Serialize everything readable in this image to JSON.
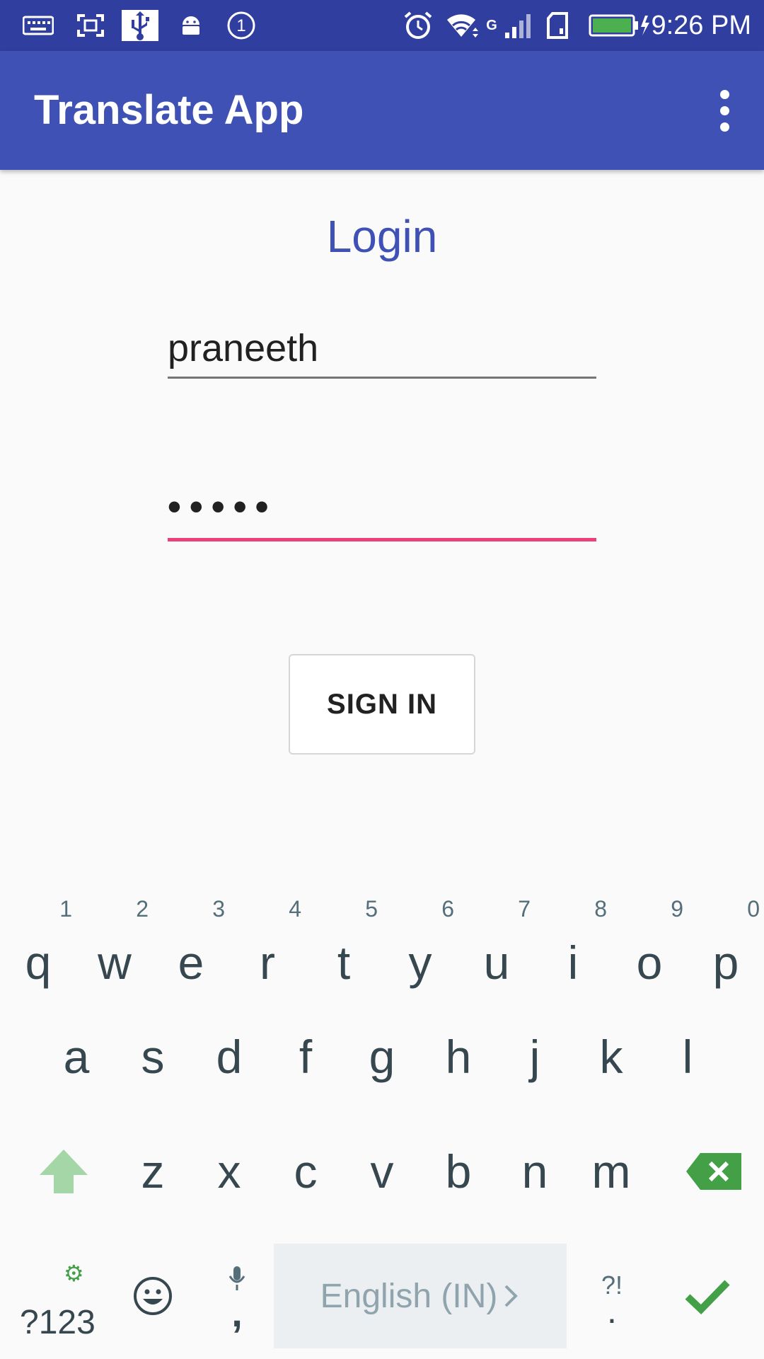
{
  "status_bar": {
    "time": "9:26 PM",
    "icons": [
      "keyboard-icon",
      "screenshot-icon",
      "usb-icon",
      "android-icon",
      "notification-count-icon",
      "alarm-icon",
      "wifi-icon",
      "cellular-signal-icon",
      "sim-icon",
      "battery-charging-icon"
    ],
    "notification_count": "1",
    "data_type": "G"
  },
  "app_bar": {
    "title": "Translate App",
    "menu_icon": "overflow-menu-icon",
    "color": "#3f51b5"
  },
  "login": {
    "title": "Login",
    "username_value": "praneeth",
    "password_value": "•••••",
    "signin_label": "SIGN IN",
    "accent_color": "#ec407a"
  },
  "keyboard": {
    "row1": [
      {
        "key": "q",
        "hint": "1"
      },
      {
        "key": "w",
        "hint": "2"
      },
      {
        "key": "e",
        "hint": "3"
      },
      {
        "key": "r",
        "hint": "4"
      },
      {
        "key": "t",
        "hint": "5"
      },
      {
        "key": "y",
        "hint": "6"
      },
      {
        "key": "u",
        "hint": "7"
      },
      {
        "key": "i",
        "hint": "8"
      },
      {
        "key": "o",
        "hint": "9"
      },
      {
        "key": "p",
        "hint": "0"
      }
    ],
    "row2": [
      "a",
      "s",
      "d",
      "f",
      "g",
      "h",
      "j",
      "k",
      "l"
    ],
    "row3": [
      "z",
      "x",
      "c",
      "v",
      "b",
      "n",
      "m"
    ],
    "symbols_label": "?123",
    "comma_label": ",",
    "space_label": "English (IN)",
    "punct_top": "?!",
    "punct_bottom": ".",
    "icons": [
      "shift-icon",
      "backspace-icon",
      "settings-gear-icon",
      "emoji-icon",
      "microphone-icon",
      "chevron-right-icon",
      "enter-check-icon"
    ],
    "accent_color": "#43a047"
  }
}
